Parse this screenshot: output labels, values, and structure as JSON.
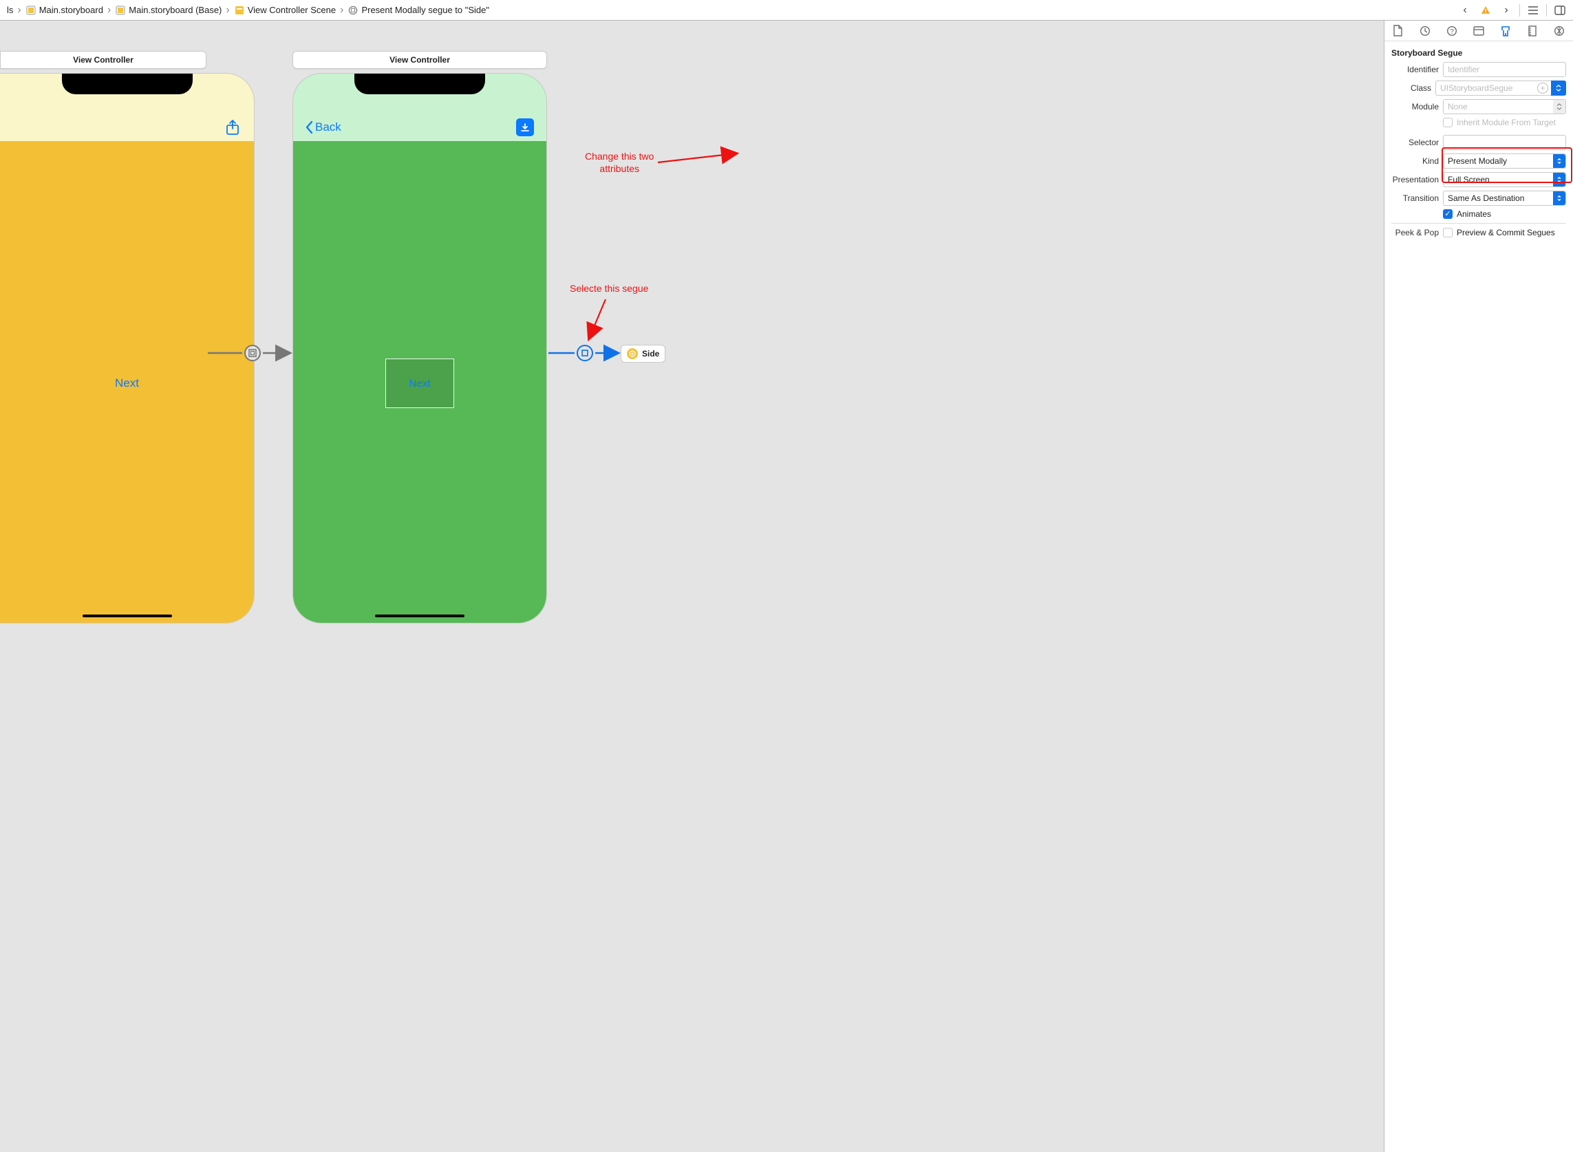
{
  "breadcrumb": {
    "seg0": "ls",
    "seg1": "Main.storyboard",
    "seg2": "Main.storyboard (Base)",
    "seg3": "View Controller Scene",
    "seg4": "Present Modally segue to \"Side\""
  },
  "scene1": {
    "title": "View Controller",
    "button": "Next"
  },
  "scene2": {
    "title": "View Controller",
    "back": "Back",
    "button": "Next"
  },
  "side_chip": "Side",
  "annotations": {
    "top": "Change this two\nattributes",
    "bottom": "Selecte this segue"
  },
  "inspector": {
    "title": "Storyboard Segue",
    "identifier_label": "Identifier",
    "identifier_placeholder": "Identifier",
    "class_label": "Class",
    "class_value": "UIStoryboardSegue",
    "module_label": "Module",
    "module_value": "None",
    "inherit_label": "Inherit Module From Target",
    "selector_label": "Selector",
    "kind_label": "Kind",
    "kind_value": "Present Modally",
    "presentation_label": "Presentation",
    "presentation_value": "Full Screen",
    "transition_label": "Transition",
    "transition_value": "Same As Destination",
    "animates_label": "Animates",
    "peekpop_label": "Peek & Pop",
    "peekpop_checkbox_label": "Preview & Commit Segues"
  }
}
